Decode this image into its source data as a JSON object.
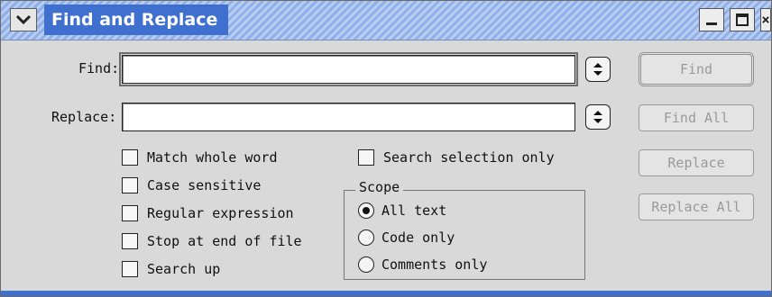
{
  "window": {
    "title": "Find and Replace"
  },
  "find": {
    "label": "Find:",
    "value": ""
  },
  "replace": {
    "label": "Replace:",
    "value": ""
  },
  "buttons": {
    "find": "Find",
    "find_all": "Find All",
    "replace": "Replace",
    "replace_all": "Replace All"
  },
  "options": {
    "match_whole_word": "Match whole word",
    "case_sensitive": "Case sensitive",
    "regular_expression": "Regular expression",
    "stop_at_end": "Stop at end of file",
    "search_up": "Search up",
    "search_selection_only": "Search selection only"
  },
  "scope": {
    "title": "Scope",
    "options": [
      "All text",
      "Code only",
      "Comments only"
    ],
    "selected": "All text"
  },
  "icons": {
    "collapse": "chevron-down-icon",
    "minimize": "minimize-icon",
    "maximize": "maximize-icon",
    "close": "close-icon",
    "stepper": "up-down-stepper-icon"
  },
  "colors": {
    "title_bg": "#3f6fcf",
    "window_bg": "#d9d9d9"
  }
}
